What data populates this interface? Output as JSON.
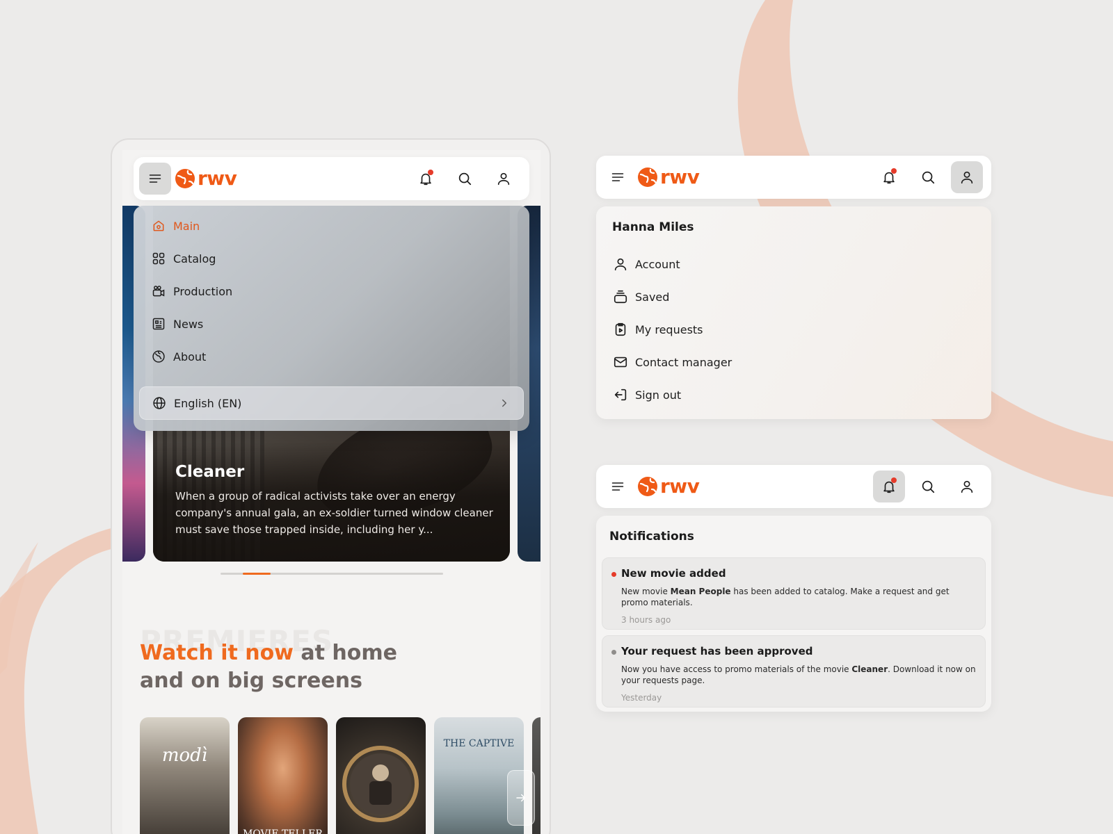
{
  "brand": {
    "logo_text": "rwv",
    "accent": "#ef6a1f"
  },
  "nav_menu": {
    "items": [
      {
        "label": "Main",
        "icon": "home-icon",
        "active": true
      },
      {
        "label": "Catalog",
        "icon": "grid-icon",
        "active": false
      },
      {
        "label": "Production",
        "icon": "camera-icon",
        "active": false
      },
      {
        "label": "News",
        "icon": "newspaper-icon",
        "active": false
      },
      {
        "label": "About",
        "icon": "globe-icon",
        "active": false
      }
    ],
    "language": "English (EN)"
  },
  "hero": {
    "title": "Cleaner",
    "description": "When a group of radical activists take over an energy company's annual gala, an ex-soldier turned window cleaner must save those trapped inside, including her y...",
    "slider_position": 0.12
  },
  "section": {
    "bg_label": "PREMIERES",
    "headline_accent": "Watch it now",
    "headline_rest1": " at home",
    "headline_line2": "and on big screens"
  },
  "posters": [
    {
      "title": "modì"
    },
    {
      "title": "MOVIE TELLER"
    },
    {
      "title": ""
    },
    {
      "title": "THE CAPTIVE"
    }
  ],
  "account": {
    "user_name": "Hanna Miles",
    "items": [
      {
        "label": "Account",
        "icon": "user-icon"
      },
      {
        "label": "Saved",
        "icon": "stack-icon"
      },
      {
        "label": "My requests",
        "icon": "clipboard-play-icon"
      },
      {
        "label": "Contact manager",
        "icon": "mail-icon"
      },
      {
        "label": "Sign out",
        "icon": "sign-out-icon"
      }
    ]
  },
  "notifications": {
    "title": "Notifications",
    "items": [
      {
        "title": "New movie added",
        "body_pre": "New movie ",
        "body_bold": "Mean People",
        "body_post": " has been added to catalog. Make a request and get promo materials.",
        "time": "3 hours ago",
        "unread": true,
        "dot_color": "#e53b2a"
      },
      {
        "title": "Your request has been approved",
        "body_pre": "Now you have access to promo materials of the movie ",
        "body_bold": "Cleaner",
        "body_post": ". Download it now on your requests page.",
        "time": "Yesterday",
        "unread": false,
        "dot_color": "#8f8d8b"
      }
    ]
  }
}
